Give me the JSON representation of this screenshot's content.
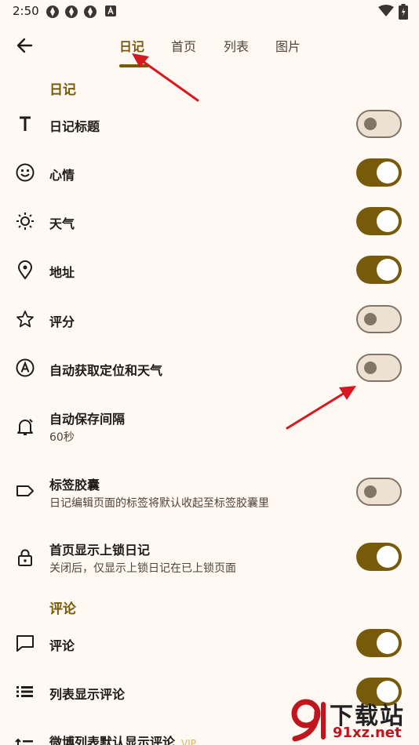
{
  "status_bar": {
    "time": "2:50"
  },
  "tabs": [
    {
      "label": "日记",
      "active": true
    },
    {
      "label": "首页",
      "active": false
    },
    {
      "label": "列表",
      "active": false
    },
    {
      "label": "图片",
      "active": false
    }
  ],
  "diary_section": {
    "title": "日记",
    "items": [
      {
        "label": "日记标题",
        "icon": "text-title-icon",
        "toggle": false
      },
      {
        "label": "心情",
        "icon": "mood-icon",
        "toggle": true
      },
      {
        "label": "天气",
        "icon": "weather-sun-icon",
        "toggle": true
      },
      {
        "label": "地址",
        "icon": "location-pin-icon",
        "toggle": true
      },
      {
        "label": "评分",
        "icon": "star-icon",
        "toggle": false
      },
      {
        "label": "自动获取定位和天气",
        "icon": "auto-locate-icon",
        "toggle": false
      },
      {
        "label": "自动保存间隔",
        "sub": "60秒",
        "icon": "alarm-icon"
      },
      {
        "label": "标签胶囊",
        "sub": "日记编辑页面的标签将默认收起至标签胶囊里",
        "icon": "tag-icon",
        "toggle": false
      },
      {
        "label": "首页显示上锁日记",
        "sub": "关闭后，仅显示上锁日记在已上锁页面",
        "icon": "lock-icon",
        "toggle": true
      }
    ]
  },
  "comment_section": {
    "title": "评论",
    "items": [
      {
        "label": "评论",
        "icon": "comment-icon",
        "toggle": true
      },
      {
        "label": "列表显示评论",
        "icon": "list-icon",
        "toggle": true
      },
      {
        "label": "微博列表默认显示评论",
        "badge": "VIP",
        "icon": "list-sort-icon"
      }
    ]
  },
  "watermark": {
    "text": "下载站",
    "domain": "91xz.net"
  },
  "colors": {
    "accent": "#785a0b",
    "background": "#fff8f3",
    "annotation_arrow": "#d8171f"
  }
}
